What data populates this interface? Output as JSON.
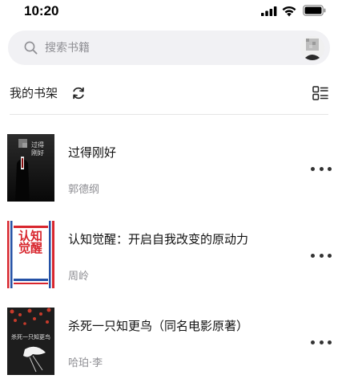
{
  "status_bar": {
    "time": "10:20",
    "signal_icon": "cellular-signal-icon",
    "wifi_icon": "wifi-icon",
    "battery_icon": "battery-icon"
  },
  "search": {
    "placeholder": "搜索书籍",
    "value": "",
    "icon": "search-icon"
  },
  "avatar": {
    "icon": "user-avatar"
  },
  "shelf": {
    "title": "我的书架",
    "refresh_icon": "refresh-icon",
    "view_toggle_icon": "list-view-icon"
  },
  "books": [
    {
      "title": "过得刚好",
      "author": "郭德纲",
      "cover_text": "过得刚好",
      "cover_colors": {
        "bg": "#141414",
        "accent": "#d8d8d8"
      },
      "more_icon": "more-dots-icon"
    },
    {
      "title": "认知觉醒：开启自我改变的原动力",
      "author": "周岭",
      "cover_text": "认知觉醒",
      "cover_colors": {
        "bg": "#ffffff",
        "accent": "#d8262e"
      },
      "more_icon": "more-dots-icon"
    },
    {
      "title": "杀死一只知更鸟（同名电影原著）",
      "author": "哈珀·李",
      "cover_text": "杀死一只知更鸟",
      "cover_colors": {
        "bg": "#1d1d1d",
        "accent": "#c73b2b"
      },
      "more_icon": "more-dots-icon"
    }
  ]
}
